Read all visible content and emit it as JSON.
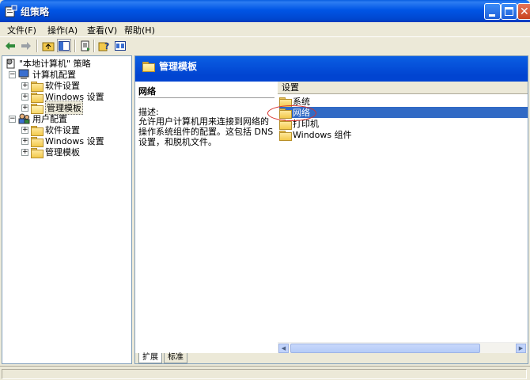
{
  "window": {
    "title": "组策略"
  },
  "menubar": [
    "文件(F)",
    "操作(A)",
    "查看(V)",
    "帮助(H)"
  ],
  "tree": {
    "root": "\"本地计算机\" 策略",
    "computer_config": "计算机配置",
    "computer_children": [
      "软件设置",
      "Windows 设置",
      "管理模板"
    ],
    "user_config": "用户配置",
    "user_children": [
      "软件设置",
      "Windows 设置",
      "管理模板"
    ]
  },
  "right": {
    "header_title": "管理模板",
    "desc_title": "网络",
    "desc_label": "描述:",
    "desc_body": "允许用户计算机用来连接到网络的操作系统组件的配置。这包括 DNS 设置，和脱机文件。",
    "column_header": "设置",
    "items": [
      "系统",
      "网络",
      "打印机",
      "Windows 组件"
    ],
    "selected_index": 1
  },
  "tabs": [
    "扩展",
    "标准"
  ]
}
